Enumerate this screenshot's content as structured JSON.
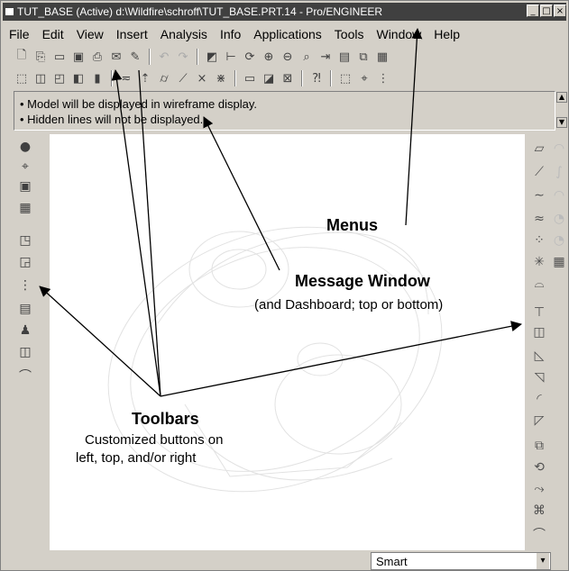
{
  "window": {
    "title": "TUT_BASE (Active)  d:\\Wildfire\\schroff\\TUT_BASE.PRT.14 - Pro/ENGINEER",
    "controls": [
      "_",
      "□",
      "×"
    ]
  },
  "menubar": {
    "items": [
      "File",
      "Edit",
      "View",
      "Insert",
      "Analysis",
      "Info",
      "Applications",
      "Tools",
      "Window",
      "Help"
    ]
  },
  "message_window": {
    "lines": [
      "• Model will be displayed in wireframe display.",
      "• Hidden lines will not be displayed."
    ]
  },
  "status": {
    "filter_value": "Smart"
  },
  "annotations": {
    "menus": "Menus",
    "message_window": "Message Window",
    "message_window_sub": "(and Dashboard; top or bottom)",
    "toolbars": "Toolbars",
    "toolbars_sub1": "Customized buttons on",
    "toolbars_sub2": "left, top, and/or right"
  },
  "toolbar_top_row1": [
    "new-icon",
    "open-icon",
    "folder-icon",
    "save-icon",
    "print-icon",
    "email-icon",
    "edit-icon",
    "undo-icon",
    "redo-icon",
    "regen-icon",
    "datum-icon",
    "orient-icon",
    "zoom-in-icon",
    "zoom-out-icon",
    "refit-icon",
    "spin-icon",
    "layers-icon",
    "views-icon",
    "model-tree-icon"
  ],
  "toolbar_top_row2": [
    "wireframe-icon",
    "hidden-line-icon",
    "no-hidden-icon",
    "shaded-icon",
    "solid-icon",
    "datum-plane-icon",
    "datum-axis-icon",
    "datum-point-icon",
    "csys-icon",
    "spin-center-icon",
    "window-icon",
    "activate-icon",
    "close-window-icon",
    "help-icon",
    "select-box-icon",
    "find-icon",
    "analysis-icon"
  ]
}
